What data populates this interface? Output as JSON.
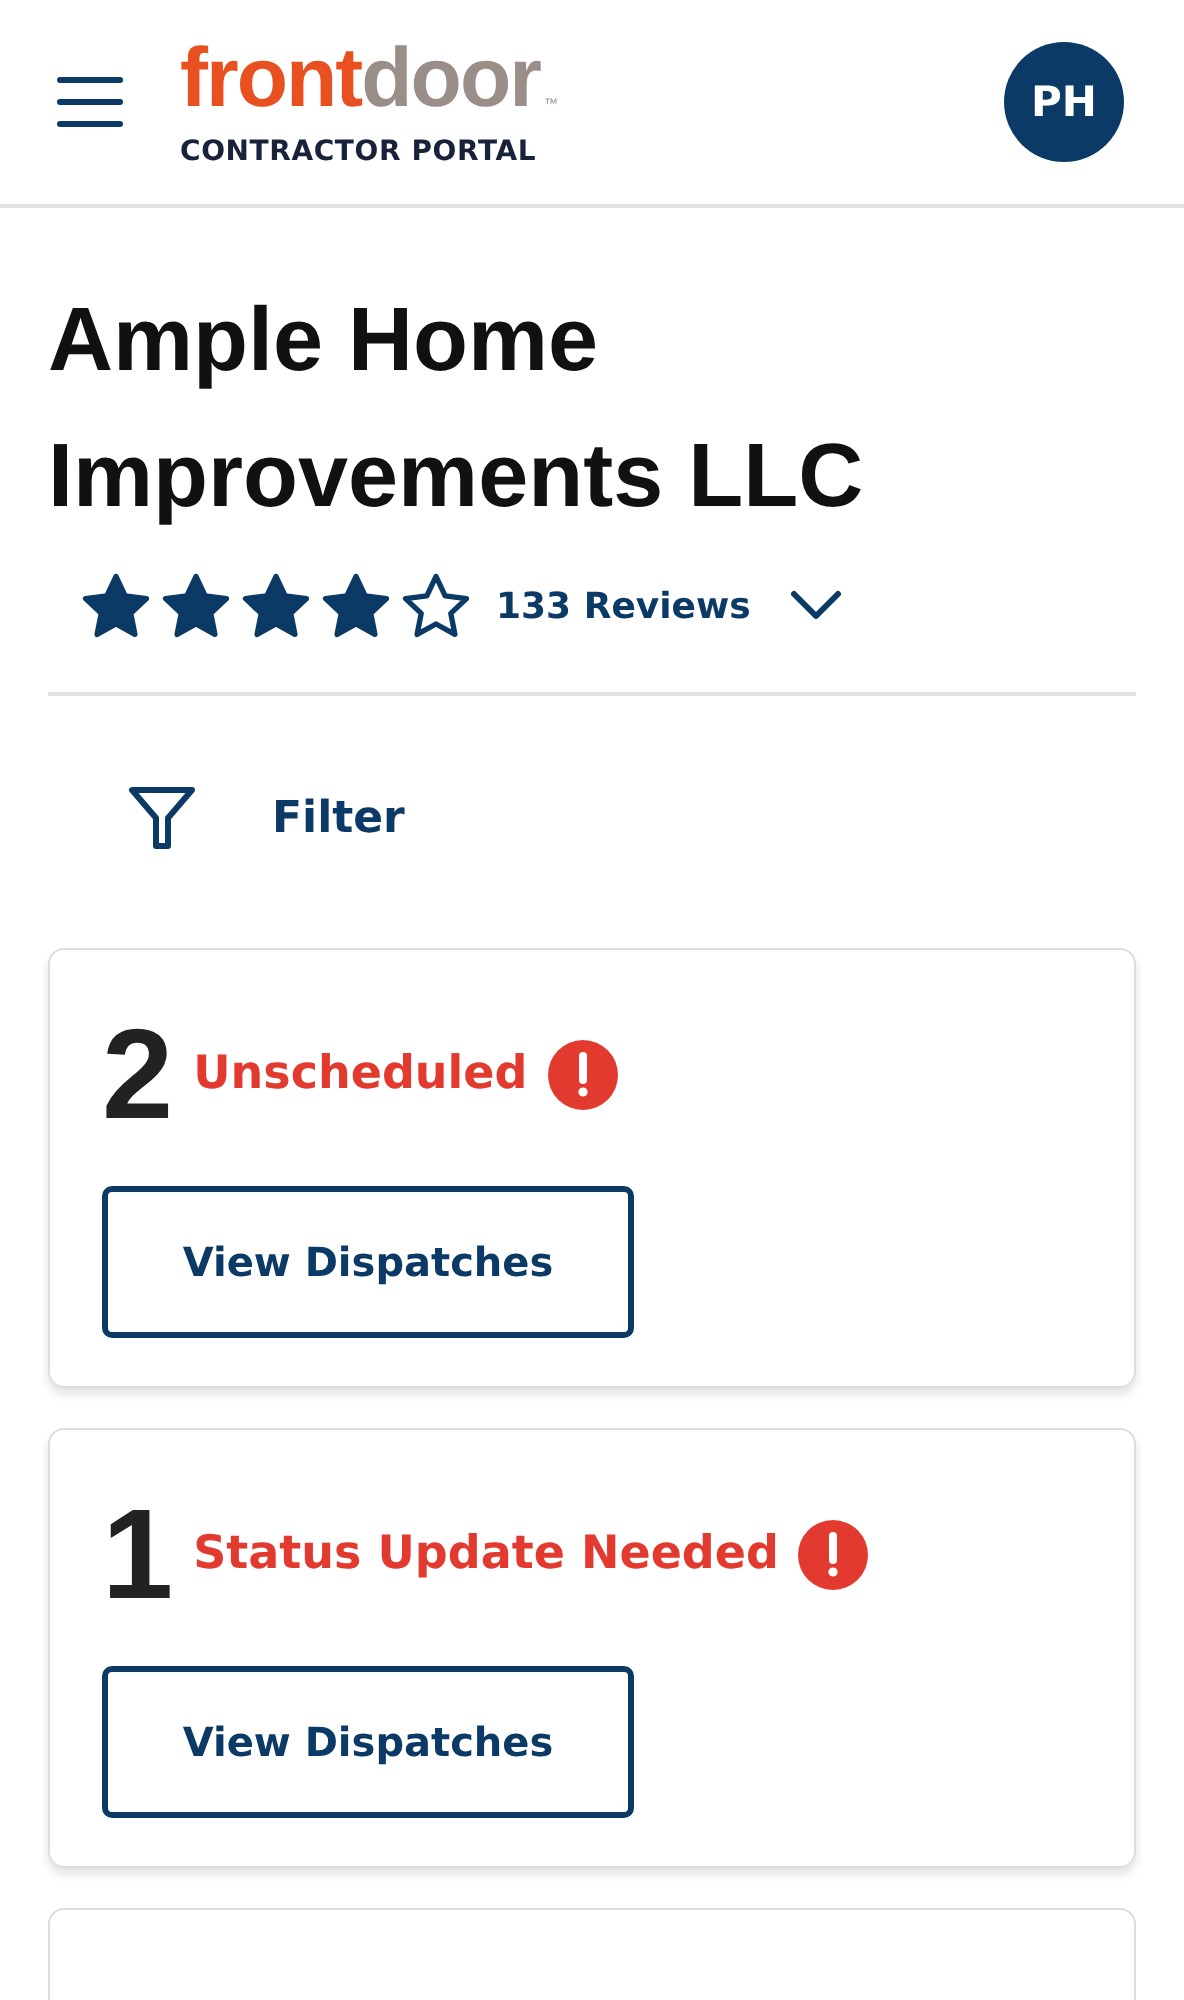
{
  "header": {
    "logo": {
      "part_1": "front",
      "part_2": "door",
      "trademark": "™"
    },
    "subtitle": "CONTRACTOR PORTAL",
    "avatar": "PH"
  },
  "company": {
    "name": "Ample Home Improvements LLC",
    "stars": 4,
    "reviews": "133 Reviews"
  },
  "filter": {
    "label": "Filter"
  },
  "cards": [
    {
      "count": "2",
      "status": "Unscheduled",
      "button": "View Dispatches"
    },
    {
      "count": "1",
      "status": "Status Update Needed",
      "button": "View Dispatches"
    }
  ]
}
